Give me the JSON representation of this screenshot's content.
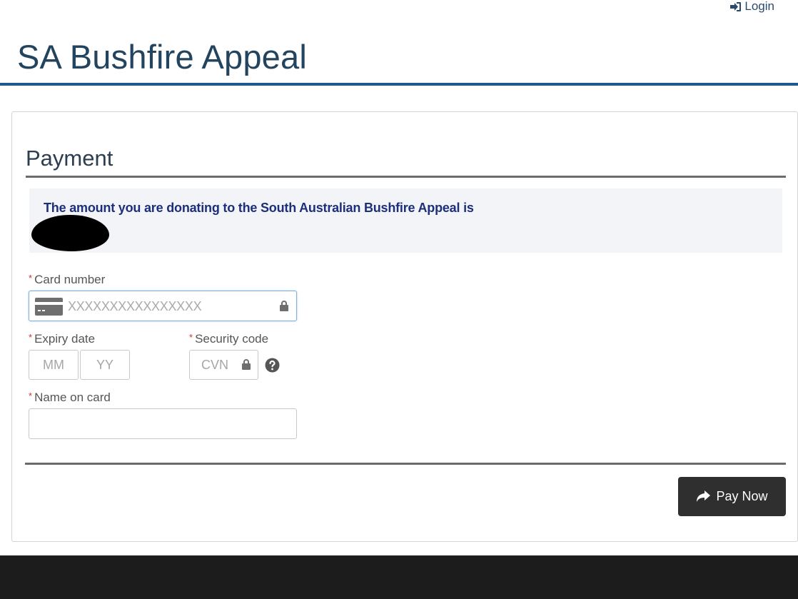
{
  "header": {
    "login_label": "Login",
    "site_title": "SA Bushfire Appeal"
  },
  "payment": {
    "title": "Payment",
    "amount_message": "The amount you are donating to the South Australian Bushfire Appeal is",
    "card_number": {
      "label": "Card number",
      "placeholder": "XXXXXXXXXXXXXXXX"
    },
    "expiry": {
      "label": "Expiry date",
      "month_placeholder": "MM",
      "year_placeholder": "YY"
    },
    "security": {
      "label": "Security code",
      "placeholder": "CVN"
    },
    "name": {
      "label": "Name on card",
      "value": ""
    },
    "required_marker": "*",
    "submit_label": "Pay Now"
  },
  "colors": {
    "title": "#23445f",
    "header_rule": "#1f5a8f",
    "amount_text": "#1c2f7a",
    "required": "#d0312d",
    "button_bg": "#2f2f2f",
    "footer_bg": "#1c1c1c"
  },
  "icons": {
    "login": "sign-in-icon",
    "card": "credit-card-icon",
    "lock": "lock-icon",
    "help": "question-circle-icon",
    "submit": "share-arrow-icon"
  }
}
